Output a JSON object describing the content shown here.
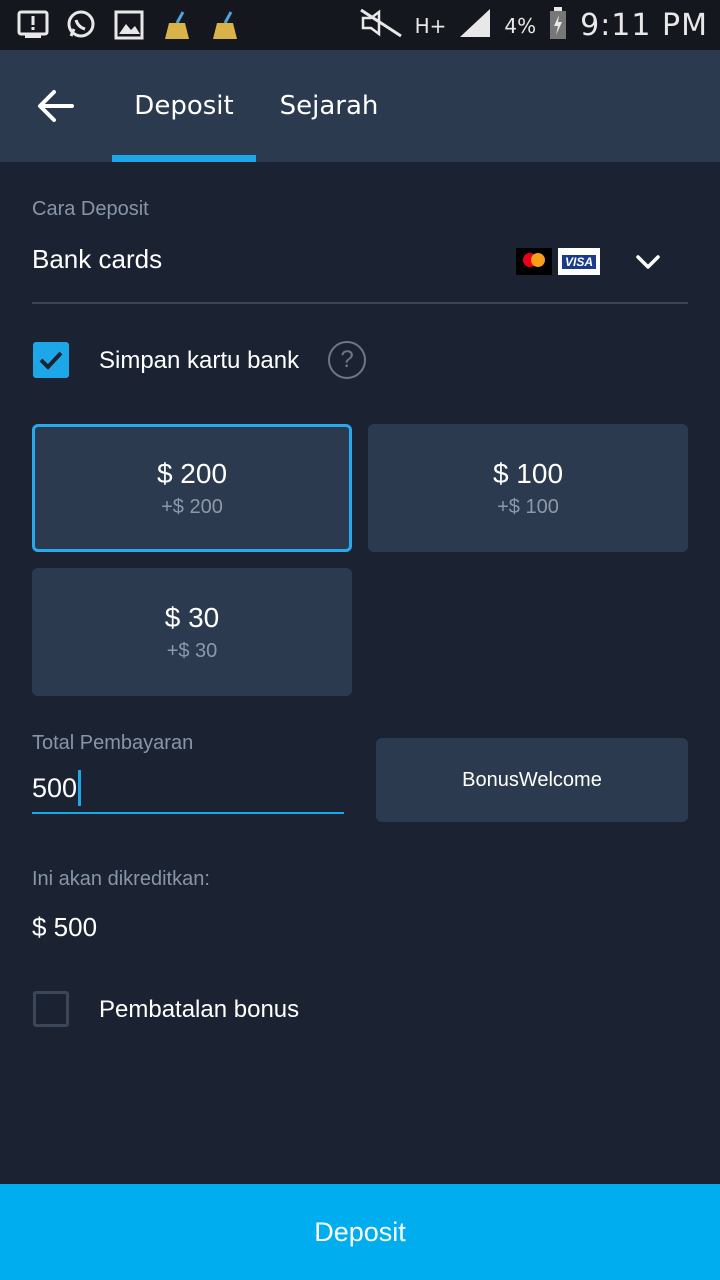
{
  "status_bar": {
    "time": "9:11 PM",
    "battery": "4%",
    "network": "H+",
    "icons": [
      "alert-icon",
      "whatsapp-icon",
      "gallery-icon",
      "broom-icon",
      "broom-icon",
      "mute-icon",
      "signal-icon",
      "battery-icon"
    ]
  },
  "tabs": [
    {
      "label": "Deposit",
      "active": true
    },
    {
      "label": "Sejarah",
      "active": false
    }
  ],
  "form": {
    "method_label": "Cara Deposit",
    "method_value": "Bank cards",
    "card_brand_visa": "VISA",
    "save_card_label": "Simpan kartu bank",
    "save_card_checked": true,
    "help_symbol": "?",
    "amount_options": [
      {
        "amount": "$ 200",
        "bonus": "+$ 200",
        "selected": true
      },
      {
        "amount": "$ 100",
        "bonus": "+$ 100",
        "selected": false
      },
      {
        "amount": "$ 30",
        "bonus": "+$ 30",
        "selected": false
      }
    ],
    "total_label": "Total Pembayaran",
    "total_value": "500",
    "bonus_code": "BonusWelcome",
    "credited_label": "Ini akan dikreditkan:",
    "credited_value": "$ 500",
    "cancel_bonus_label": "Pembatalan bonus",
    "cancel_bonus_checked": false
  },
  "submit_label": "Deposit",
  "colors": {
    "background": "#1b2332",
    "appbar": "#2b3a4f",
    "accent": "#1ea7e8",
    "submit": "#00aef0"
  }
}
